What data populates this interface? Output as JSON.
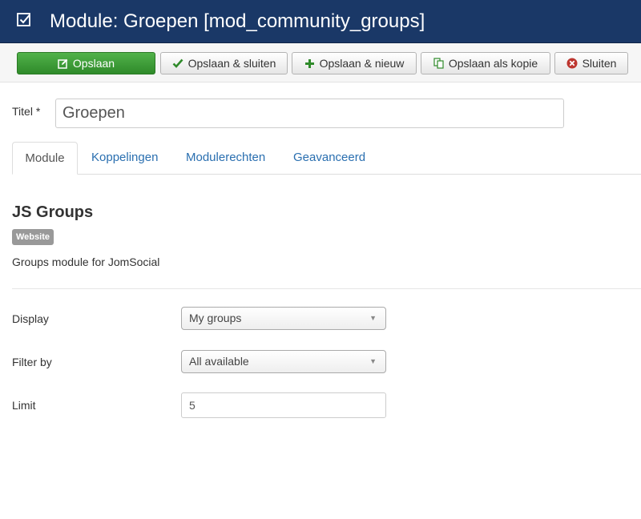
{
  "header": {
    "title": "Module: Groepen [mod_community_groups]",
    "icon": "checkbox-icon"
  },
  "toolbar": {
    "save": "Opslaan",
    "save_close": "Opslaan & sluiten",
    "save_new": "Opslaan & nieuw",
    "save_copy": "Opslaan als kopie",
    "close": "Sluiten"
  },
  "title_field": {
    "label": "Titel *",
    "value": "Groepen"
  },
  "tabs": [
    {
      "label": "Module",
      "active": true
    },
    {
      "label": "Koppelingen",
      "active": false
    },
    {
      "label": "Modulerechten",
      "active": false
    },
    {
      "label": "Geavanceerd",
      "active": false
    }
  ],
  "module": {
    "name": "JS Groups",
    "badge": "Website",
    "description": "Groups module for JomSocial"
  },
  "fields": {
    "display": {
      "label": "Display",
      "value": "My groups"
    },
    "filter": {
      "label": "Filter by",
      "value": "All available"
    },
    "limit": {
      "label": "Limit",
      "value": "5"
    }
  },
  "colors": {
    "header_bg": "#1a3867",
    "primary_green": "#3e9c37",
    "link_blue": "#2a6fb0",
    "close_red": "#bd362f"
  }
}
